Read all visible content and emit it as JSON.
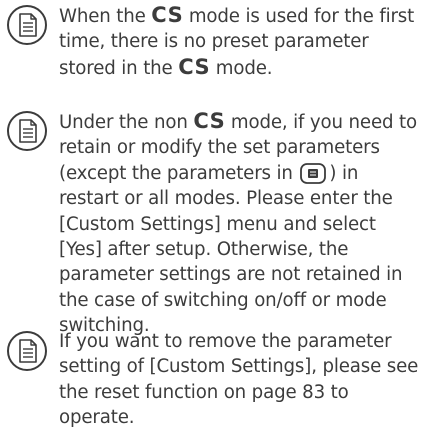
{
  "notes": [
    {
      "icon": "note-icon",
      "text_before_cs1": "When the ",
      "cs": "CS",
      "text_mid": " mode is used for the first time, there is no preset parameter stored in the ",
      "text_after_cs2": " mode."
    },
    {
      "icon": "note-icon",
      "text_before_cs": "Under the non ",
      "cs": "CS",
      "text_before_chip": " mode, if you need to retain or modify the set parameters (except the parameters in ",
      "chip_icon": "menu-button-icon",
      "text_after_chip": ") in restart or all modes. Please enter the [Custom Settings] menu and select [Yes] after setup. Otherwise, the parameter settings are not retained in the case of switching on/off or mode switching."
    },
    {
      "icon": "note-icon",
      "text": "If you want to remove the parameter setting of [Custom Settings], please see the reset function on page 83 to operate."
    }
  ],
  "colors": {
    "text": "#3c3c3c",
    "icon_stroke": "#3c3c3c"
  }
}
